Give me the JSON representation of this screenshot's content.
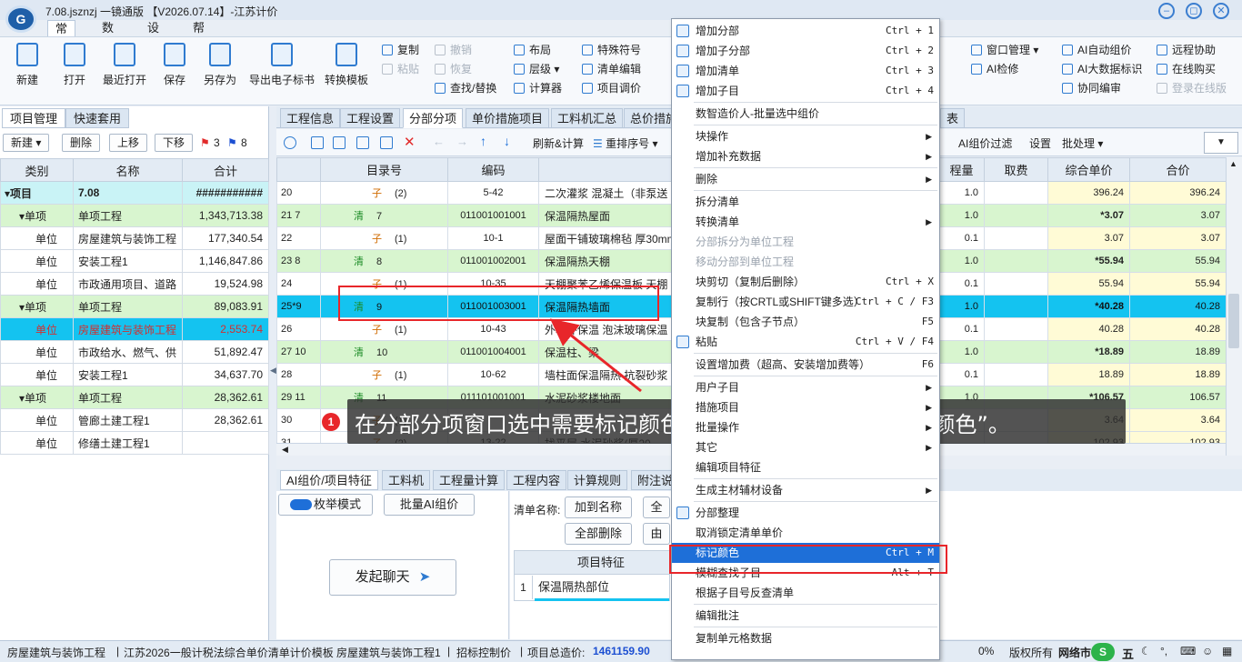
{
  "window": {
    "title": "7.08.jsznzj  一镜通版 【V2026.07.14】-江苏计价"
  },
  "menu_tabs": [
    "常用",
    "数据",
    "设置",
    "帮助"
  ],
  "ribbon": {
    "big_buttons": [
      "新建",
      "打开",
      "最近打开",
      "保存",
      "另存为",
      "导出电子标书",
      "转换模板"
    ],
    "small": {
      "copy": "复制",
      "paste": "粘贴",
      "undo": "撤销",
      "redo": "恢复",
      "find_replace": "查找/替换",
      "layout": "布局",
      "level": "层级",
      "calculator": "计算器",
      "special_symbol": "特殊符号",
      "list_edit": "清单编辑",
      "item_adjust": "项目调价",
      "window_mgmt": "窗口管理",
      "ai_check": "AI检修",
      "ai_autoprice": "AI自动组价",
      "ai_bigdata": "AI大数据标识",
      "collab_edit": "协同编审",
      "remote_help": "远程协助",
      "online_buy": "在线购买",
      "online_login": "登录在线版"
    }
  },
  "left_panel": {
    "tabs": [
      "项目管理",
      "快速套用"
    ],
    "buttons": [
      "新建",
      "删除",
      "上移",
      "下移"
    ],
    "flag_red_count": "3",
    "flag_blue_count": "8",
    "columns": [
      "类别",
      "名称",
      "合计"
    ],
    "rows": [
      {
        "cat": "▾项目",
        "name": "7.08",
        "total": "###########"
      },
      {
        "cat": "▾单项",
        "name": "单项工程",
        "total": "1,343,713.38"
      },
      {
        "cat": "单位",
        "name": "房屋建筑与装饰工程",
        "total": "177,340.54"
      },
      {
        "cat": "单位",
        "name": "安装工程1",
        "total": "1,146,847.86"
      },
      {
        "cat": "单位",
        "name": "市政通用项目、道路",
        "total": "19,524.98"
      },
      {
        "cat": "▾单项",
        "name": "单项工程",
        "total": "89,083.91"
      },
      {
        "cat": "单位",
        "name": "房屋建筑与装饰工程",
        "total": "2,553.74"
      },
      {
        "cat": "单位",
        "name": "市政给水、燃气、供",
        "total": "51,892.47"
      },
      {
        "cat": "单位",
        "name": "安装工程1",
        "total": "34,637.70"
      },
      {
        "cat": "▾单项",
        "name": "单项工程",
        "total": "28,362.61"
      },
      {
        "cat": "单位",
        "name": "管廊土建工程1",
        "total": "28,362.61"
      },
      {
        "cat": "单位",
        "name": "修缮土建工程1",
        "total": ""
      }
    ]
  },
  "main_tabs": [
    "工程信息",
    "工程设置",
    "分部分项",
    "单价措施项目",
    "工料机汇总",
    "总价措施",
    "表"
  ],
  "toolbar2": {
    "refresh_calc": "刷新&计算",
    "renumber": "重排序号",
    "ai_filter": "AI组价过滤",
    "settings": "设置",
    "batch": "批处理"
  },
  "grid": {
    "columns": [
      "",
      "目录号",
      "编码",
      "名称",
      "程量",
      "取费",
      "综合单价",
      "合价"
    ],
    "rows": [
      {
        "no": "20",
        "dir": "子",
        "sub": "(2)",
        "code": "5-42",
        "name": "二次灌浆 混凝土（非泵送",
        "qty": "1.0",
        "unit_price": "396.24",
        "total": "396.24",
        "type": "zi"
      },
      {
        "no": "21 7",
        "dir": "清",
        "sub": "7",
        "code": "011001001001",
        "name": "保温隔热屋面",
        "qty": "1.0",
        "unit_price": "*3.07",
        "total": "3.07",
        "type": "qing"
      },
      {
        "no": "22",
        "dir": "子",
        "sub": "(1)",
        "code": "10-1",
        "name": "屋面干铺玻璃棉毡 厚30mm",
        "qty": "0.1",
        "unit_price": "3.07",
        "total": "3.07",
        "type": "zi"
      },
      {
        "no": "23 8",
        "dir": "清",
        "sub": "8",
        "code": "011001002001",
        "name": "保温隔热天棚",
        "qty": "1.0",
        "unit_price": "*55.94",
        "total": "55.94",
        "type": "qing"
      },
      {
        "no": "24",
        "dir": "子",
        "sub": "(1)",
        "code": "10-35",
        "name": "天棚聚苯乙烯保温板 天棚",
        "qty": "0.1",
        "unit_price": "55.94",
        "total": "55.94",
        "type": "zi"
      },
      {
        "no": "25*9",
        "dir": "清",
        "sub": "9",
        "code": "011001003001",
        "name": "保温隔热墙面",
        "qty": "1.0",
        "unit_price": "*40.28",
        "total": "40.28",
        "type": "sel"
      },
      {
        "no": "26",
        "dir": "子",
        "sub": "(1)",
        "code": "10-43",
        "name": "外墙外保温 泡沫玻璃保温",
        "qty": "0.1",
        "unit_price": "40.28",
        "total": "40.28",
        "type": "zi"
      },
      {
        "no": "27 10",
        "dir": "清",
        "sub": "10",
        "code": "011001004001",
        "name": "保温柱、梁",
        "qty": "1.0",
        "unit_price": "*18.89",
        "total": "18.89",
        "type": "qing"
      },
      {
        "no": "28",
        "dir": "子",
        "sub": "(1)",
        "code": "10-62",
        "name": "墙柱面保温隔热 抗裂砂浆",
        "qty": "0.1",
        "unit_price": "18.89",
        "total": "18.89",
        "type": "zi"
      },
      {
        "no": "29 11",
        "dir": "清",
        "sub": "11",
        "code": "011101001001",
        "name": "水泥砂浆楼地面",
        "qty": "1.0",
        "unit_price": "*106.57",
        "total": "106.57",
        "type": "qing"
      },
      {
        "no": "30",
        "dir": "子",
        "sub": "(1)",
        "code": "",
        "name": "",
        "qty": "",
        "unit_price": "3.64",
        "total": "3.64",
        "type": "zi"
      },
      {
        "no": "31",
        "dir": "子",
        "sub": "(2)",
        "code": "13-22",
        "name": "找平层 水泥砂浆(厚20",
        "qty": "",
        "unit_price": "102.93",
        "total": "102.93",
        "type": "zi"
      }
    ]
  },
  "bottom": {
    "tabs": [
      "AI组价/项目特征",
      "工料机",
      "工程量计算",
      "工程内容",
      "计算规则",
      "附注说"
    ],
    "enum_mode": "枚举模式",
    "batch_ai": "批量AI组价",
    "start_chat": "发起聊天",
    "list_name_label": "清单名称:",
    "add_to_name": "加到名称",
    "delete_all": "全部删除",
    "btn_quan": "全",
    "btn_you": "由",
    "feature_header": "项目特征",
    "feature_row_no": "1",
    "feature_row_text": "保温隔热部位"
  },
  "banner": {
    "step": "1",
    "text": "在分部分项窗口选中需要标记颜色的行，鼠标右击选择“标记颜色”。"
  },
  "context_menu": [
    {
      "label": "增加分部",
      "shortcut": "Ctrl + 1",
      "icon": true
    },
    {
      "label": "增加子分部",
      "shortcut": "Ctrl + 2",
      "icon": true
    },
    {
      "label": "增加清单",
      "shortcut": "Ctrl + 3",
      "icon": true
    },
    {
      "label": "增加子目",
      "shortcut": "Ctrl + 4",
      "icon": true
    },
    {
      "sep": true
    },
    {
      "label": "数智造价人-批量选中组价",
      "shortcut": ""
    },
    {
      "sep": true
    },
    {
      "label": "块操作",
      "arrow": true
    },
    {
      "label": "增加补充数据",
      "arrow": true
    },
    {
      "sep": true
    },
    {
      "label": "删除",
      "arrow": true
    },
    {
      "sep": true
    },
    {
      "label": "拆分清单"
    },
    {
      "label": "转换清单",
      "arrow": true
    },
    {
      "label": "分部拆分为单位工程",
      "disabled": true
    },
    {
      "label": "移动分部到单位工程",
      "disabled": true
    },
    {
      "label": "块剪切（复制后删除）",
      "shortcut": "Ctrl + X"
    },
    {
      "label": "复制行（按CRTL或SHIFT键多选）",
      "shortcut": "Ctrl + C / F3"
    },
    {
      "label": "块复制（包含子节点）",
      "shortcut": "F5"
    },
    {
      "label": "粘贴",
      "shortcut": "Ctrl + V / F4",
      "icon": true
    },
    {
      "sep": true
    },
    {
      "label": "设置增加费（超高、安装增加费等）",
      "shortcut": "F6"
    },
    {
      "sep": true
    },
    {
      "label": "用户子目",
      "arrow": true
    },
    {
      "label": "措施项目",
      "arrow": true
    },
    {
      "label": "批量操作",
      "arrow": true
    },
    {
      "label": "其它",
      "arrow": true
    },
    {
      "label": "编辑项目特征"
    },
    {
      "sep": true
    },
    {
      "label": "生成主材辅材设备",
      "arrow": true
    },
    {
      "sep": true
    },
    {
      "label": "分部整理",
      "icon": true
    },
    {
      "label": "取消锁定清单单价"
    },
    {
      "label": "标记颜色",
      "shortcut": "Ctrl + M",
      "highlight": true
    },
    {
      "label": "模糊查找子目",
      "shortcut": "Alt + T"
    },
    {
      "label": "根据子目号反查清单"
    },
    {
      "sep": true
    },
    {
      "label": "编辑批注"
    },
    {
      "sep": true
    },
    {
      "label": "复制单元格数据"
    }
  ],
  "status_bar": {
    "unit": "房屋建筑与装饰工程",
    "template": "江苏2026一般计税法综合单价清单计价模板 房屋建筑与装饰工程1",
    "bid_control": "招标控制价",
    "total_label": "项目总造价:",
    "total_value": "1461159.90",
    "percent": "0%",
    "copyright": "版权所有",
    "network": "网络市",
    "ime": "五"
  }
}
